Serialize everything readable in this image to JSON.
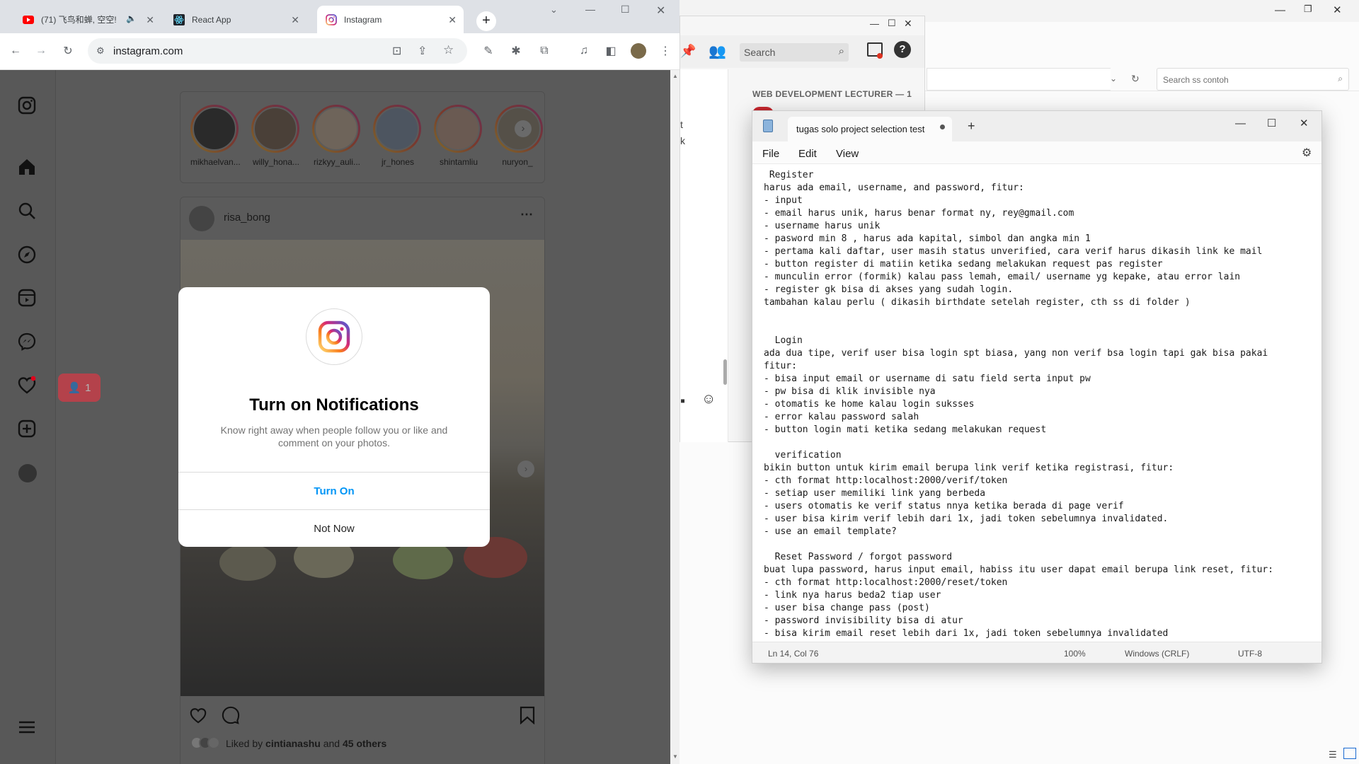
{
  "browser": {
    "tabs": [
      {
        "label": "(71) 飞鸟和蝉, 空空!",
        "favicon": "youtube-icon"
      },
      {
        "label": "React App",
        "favicon": "react-icon"
      },
      {
        "label": "Instagram",
        "favicon": "instagram-icon"
      }
    ],
    "url": "instagram.com"
  },
  "instagram": {
    "stories": [
      "mikhaelvan...",
      "willy_hona...",
      "rizkyy_auli...",
      "jr_hones",
      "shintamliu",
      "nuryon_"
    ],
    "post": {
      "username": "risa_bong",
      "liked_by_prefix": "Liked by",
      "liked_by_user": "cintianashu",
      "liked_by_and": "and",
      "liked_by_others": "45 others"
    },
    "notification_badge": "1",
    "modal": {
      "title": "Turn on Notifications",
      "body": "Know right away when people follow you or like and comment on your photos.",
      "primary": "Turn On",
      "secondary": "Not Now"
    }
  },
  "background_app": {
    "search_placeholder": "Search",
    "section_label": "WEB DEVELOPMENT LECTURER — 1"
  },
  "explorer": {
    "search_placeholder": "Search ss contoh"
  },
  "notepad": {
    "tab_title": "tugas solo project selection test",
    "menu": [
      "File",
      "Edit",
      "View"
    ],
    "lines": [
      " Register",
      "harus ada email, username, and password, fitur:",
      "- input",
      "- email harus unik, harus benar format ny, rey@gmail.com",
      "- username harus unik",
      "- pasword min 8 , harus ada kapital, simbol dan angka min 1",
      "- pertama kali daftar, user masih status unverified, cara verif harus dikasih link ke mail",
      "- button register di matiin ketika sedang melakukan request pas register",
      "- munculin error (formik) kalau pass lemah, email/ username yg kepake, atau error lain",
      "- register gk bisa di akses yang sudah login.",
      "tambahan kalau perlu ( dikasih birthdate setelah register, cth ss di folder )",
      "",
      "",
      "  Login",
      "ada dua tipe, verif user bisa login spt biasa, yang non verif bsa login tapi gak bisa pakai",
      "fitur:",
      "- bisa input email or username di satu field serta input pw",
      "- pw bisa di klik invisible nya",
      "- otomatis ke home kalau login suksses",
      "- error kalau password salah",
      "- button login mati ketika sedang melakukan request",
      "",
      "  verification",
      "bikin button untuk kirim email berupa link verif ketika registrasi, fitur:",
      "- cth format http:localhost:2000/verif/token",
      "- setiap user memiliki link yang berbeda",
      "- users otomatis ke verif status nnya ketika berada di page verif",
      "- user bisa kirim verif lebih dari 1x, jadi token sebelumnya invalidated.",
      "- use an email template?",
      "",
      "  Reset Password / forgot password",
      "buat lupa password, harus input email, habiss itu user dapat email berupa link reset, fitur:",
      "- cth format http:localhost:2000/reset/token",
      "- link nya harus beda2 tiap user",
      "- user bisa change pass (post)",
      "- password invisibility bisa di atur",
      "- bisa kirim email reset lebih dari 1x, jadi token sebelumnya invalidated"
    ],
    "status": {
      "position": "Ln 14, Col 76",
      "zoom": "100%",
      "line_ending": "Windows (CRLF)",
      "encoding": "UTF-8"
    }
  }
}
